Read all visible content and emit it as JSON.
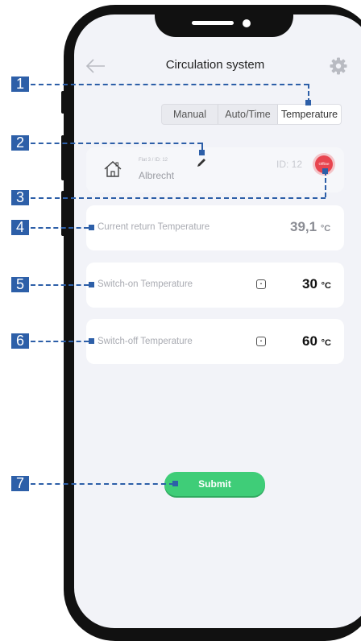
{
  "header": {
    "title": "Circulation system",
    "back_icon": "arrow-left-icon",
    "settings_icon": "gear-icon"
  },
  "mode_tabs": {
    "manual": "Manual",
    "auto_time": "Auto/Time",
    "temperature": "Temperature",
    "selected": "Temperature"
  },
  "flat": {
    "subtitle": "Flat 3 / ID: 12",
    "name": "Albrecht",
    "id_label": "ID: 12",
    "status": "Offline",
    "status_color": "#e8454f"
  },
  "rows": {
    "current": {
      "label": "Current return Temperature",
      "value": "39,1",
      "unit": "°C"
    },
    "switch_on": {
      "label": "Switch-on Temperature",
      "value": "30",
      "unit": "°C"
    },
    "switch_off": {
      "label": "Switch-off Temperature",
      "value": "60",
      "unit": "°C"
    }
  },
  "submit_label": "Submit",
  "callouts": [
    "1",
    "2",
    "3",
    "4",
    "5",
    "6",
    "7"
  ],
  "colors": {
    "accent": "#3fcd78",
    "callout": "#2d5fa8",
    "status": "#e8454f"
  }
}
